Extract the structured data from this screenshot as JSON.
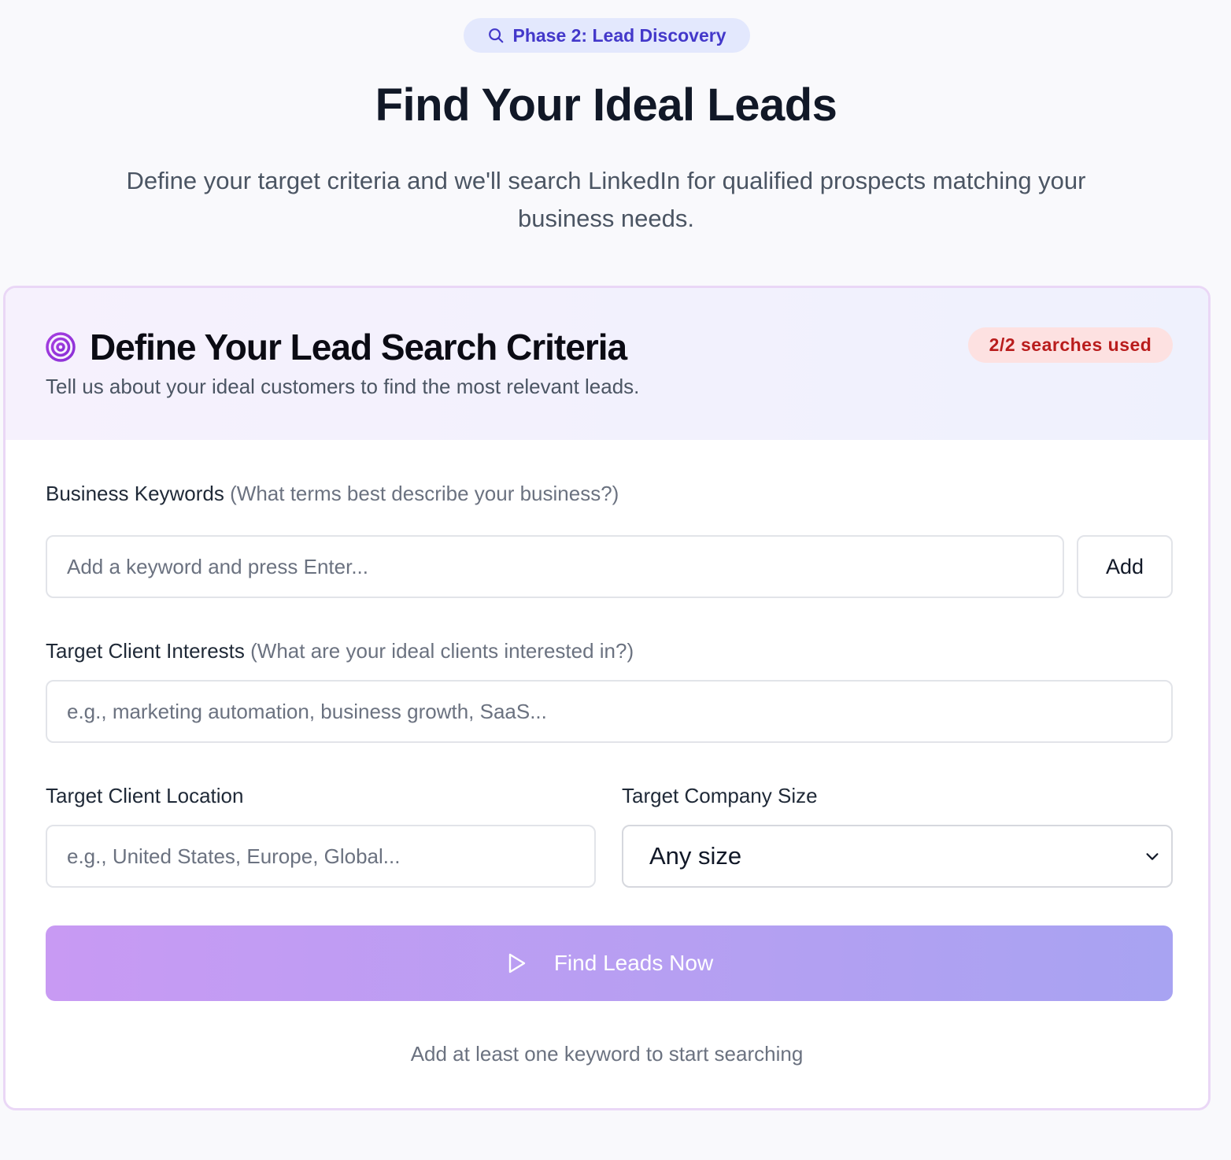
{
  "phase_badge": {
    "icon": "search-icon",
    "label": "Phase 2: Lead Discovery"
  },
  "hero": {
    "title": "Find Your Ideal Leads",
    "subtitle": "Define your target criteria and we'll search LinkedIn for qualified prospects matching your business needs."
  },
  "card": {
    "icon": "target-icon",
    "title": "Define Your Lead Search Criteria",
    "description": "Tell us about your ideal customers to find the most relevant leads.",
    "usage_badge": "2/2 searches used"
  },
  "fields": {
    "keywords": {
      "label": "Business Keywords",
      "hint": "(What terms best describe your business?)",
      "placeholder": "Add a keyword and press Enter...",
      "add_label": "Add"
    },
    "interests": {
      "label": "Target Client Interests",
      "hint": "(What are your ideal clients interested in?)",
      "placeholder": "e.g., marketing automation, business growth, SaaS..."
    },
    "location": {
      "label": "Target Client Location",
      "placeholder": "e.g., United States, Europe, Global..."
    },
    "company_size": {
      "label": "Target Company Size",
      "value": "Any size"
    }
  },
  "find_button": {
    "icon": "play-icon",
    "label": "Find Leads Now"
  },
  "helper_text": "Add at least one keyword to start searching",
  "colors": {
    "badge_bg": "#e3e8fd",
    "badge_text": "#4338ca",
    "usage_bg": "#fde1e1",
    "usage_text": "#b91c1c",
    "button_gradient_start": "#c89af3",
    "button_gradient_end": "#a8a3f2",
    "card_border": "#ead7f6"
  }
}
